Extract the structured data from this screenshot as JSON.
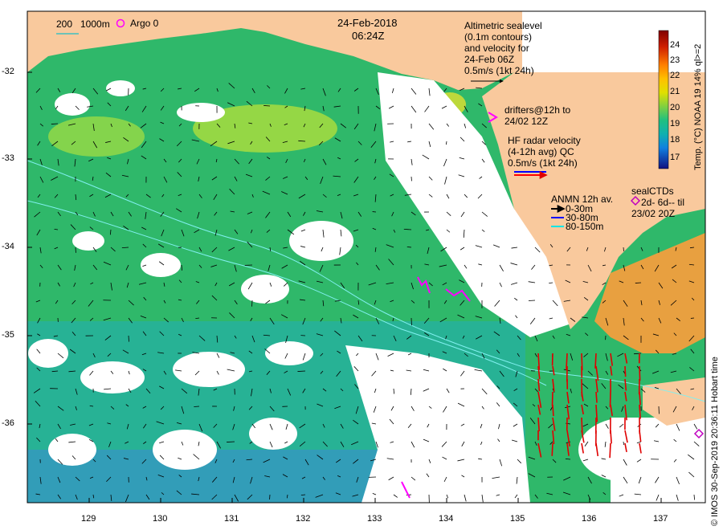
{
  "map": {
    "date": "24-Feb-2018",
    "time": "06:24Z",
    "x_axis": {
      "ticks": [
        "129",
        "130",
        "131",
        "132",
        "133",
        "134",
        "135",
        "136",
        "137"
      ]
    },
    "y_axis": {
      "ticks": [
        "-32",
        "-33",
        "-34",
        "-35",
        "-36"
      ]
    },
    "colors": {
      "land": "#f9c99d",
      "no_data": "#ffffff",
      "drifter": "#ff00ff",
      "hf_radar": "#ff0000"
    }
  },
  "legend_topleft": {
    "scale_label": "200",
    "depth_label": "1000m",
    "argo_label": "Argo 0"
  },
  "altimetry_note": [
    "Altimetric sealevel",
    "(0.1m contours)",
    "and velocity for",
    "24-Feb 06Z",
    "0.5m/s (1kt 24h)"
  ],
  "drifters_note": [
    "drifters@12h to",
    "24/02 12Z"
  ],
  "hfradar_note": [
    "HF radar velocity",
    "(4-12h avg) QC",
    "0.5m/s (1kt 24h)"
  ],
  "anmn_legend": {
    "title": "ANMN 12h av.",
    "items": [
      "0-30m",
      "30-80m",
      "80-150m"
    ],
    "colors": [
      "#000000",
      "#0000ff",
      "#00e5e5"
    ]
  },
  "sealctd_legend": [
    "sealCTDs",
    "2d- 6d-- til",
    "23/02 20Z"
  ],
  "colorbar": {
    "ticks": [
      "24",
      "23",
      "22",
      "21",
      "20",
      "19",
      "18",
      "17"
    ],
    "title": "Temp. (°C) NOAA 19 14% ql>=2",
    "palette": [
      "#800000",
      "#c00000",
      "#ff3000",
      "#ff8000",
      "#ffc000",
      "#e0e000",
      "#a0e030",
      "#50d050",
      "#20c080",
      "#10b0b0",
      "#1080e0",
      "#0040c0",
      "#101080"
    ]
  },
  "credit": "© IMOS 30-Sep-2019 20:36:11 Hobart time"
}
